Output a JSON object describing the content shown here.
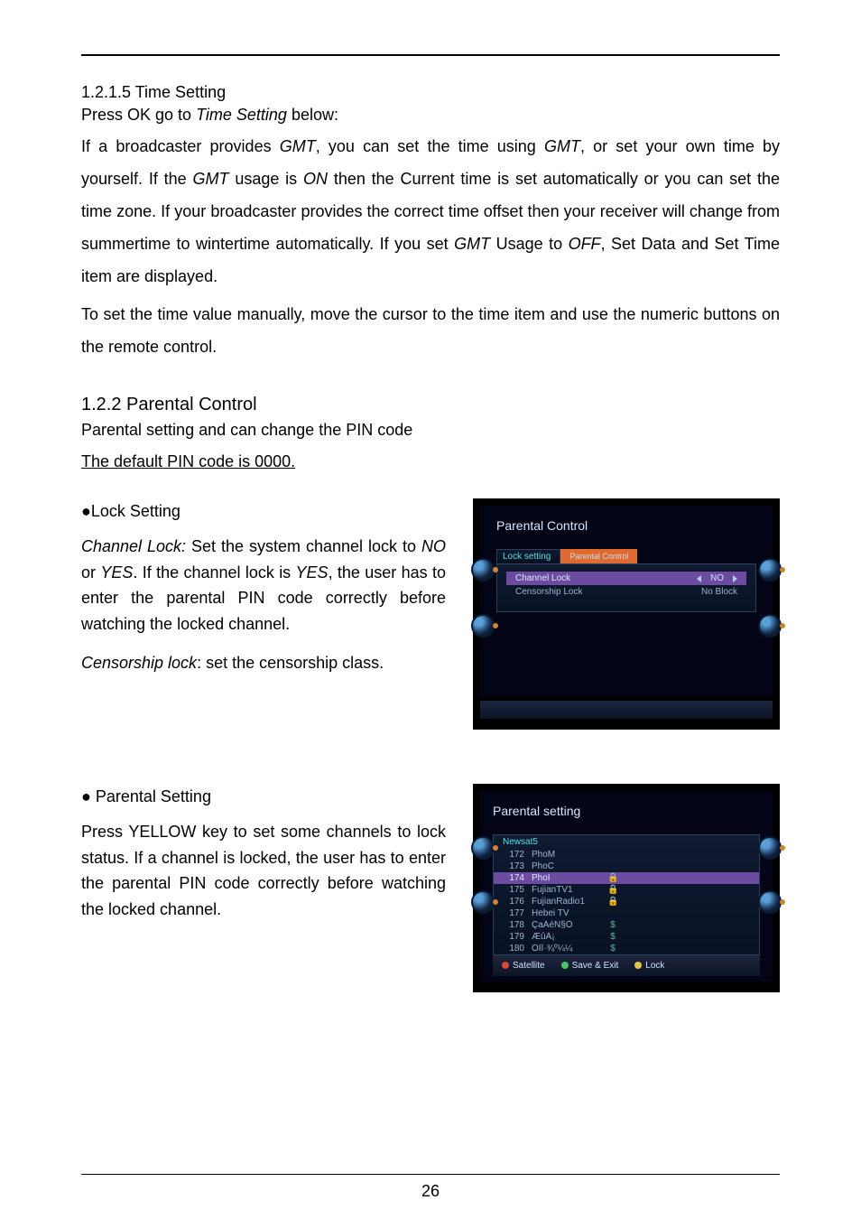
{
  "section1": {
    "heading": "1.2.1.5 Time Setting",
    "subline_pre": "Press OK go to ",
    "subline_em": "Time Setting",
    "subline_post": " below:",
    "para1_a": "If a broadcaster provides ",
    "para1_em1": "GMT",
    "para1_b": ", you can set the time using ",
    "para1_em2": "GMT",
    "para1_c": ", or set your own time by yourself. If the ",
    "para1_em3": "GMT",
    "para1_d": " usage is ",
    "para1_em4": "ON",
    "para1_e": " then the Current time is set automatically or you can set the time zone. If your broadcaster provides the correct time offset then your receiver will change from summertime to wintertime automatically. If you set ",
    "para1_em5": "GMT",
    "para1_f": " Usage to ",
    "para1_em6": "OFF",
    "para1_g": ", Set Data and Set Time item are displayed.",
    "para2": "To set the time value manually, move the cursor to the time item and use the numeric buttons on the remote control."
  },
  "section2": {
    "heading": "1.2.2 Parental Control",
    "sub1": "Parental setting and can change the PIN code",
    "default_pin": "The default PIN code is 0000.",
    "lock_heading": "●Lock Setting",
    "lock_em1": "Channel Lock:",
    "lock_a": " Set the system channel lock to ",
    "lock_em2": "NO",
    "lock_b": " or ",
    "lock_em3": "YES",
    "lock_c": ". If the channel lock is ",
    "lock_em4": "YES",
    "lock_d": ", the user has to enter the parental PIN code correctly before watching the locked channel.",
    "cens_em": "Censorship lock",
    "cens_txt": ": set the censorship class.",
    "parental_heading": "● Parental Setting",
    "parental_body": "Press YELLOW key to set some channels to lock status. If a channel is locked, the user has to enter the parental PIN code correctly before watching the locked channel."
  },
  "shot1": {
    "title": "Parental Control",
    "tab1": "Lock setting",
    "tab2": "Parental Control",
    "row1_label": "Channel Lock",
    "row1_value": "NO",
    "row2_label": "Censorship Lock",
    "row2_value": "No Block"
  },
  "shot2": {
    "title": "Parental setting",
    "sat": "Newsat5",
    "rows": [
      {
        "n": "172",
        "name": "PhoM",
        "icon": ""
      },
      {
        "n": "173",
        "name": "PhoC",
        "icon": ""
      },
      {
        "n": "174",
        "name": "PhoI",
        "icon": "lock",
        "sel": true
      },
      {
        "n": "175",
        "name": "FujianTV1",
        "icon": "lock"
      },
      {
        "n": "176",
        "name": "FujianRadio1",
        "icon": "lock"
      },
      {
        "n": "177",
        "name": "Hebei TV",
        "icon": ""
      },
      {
        "n": "178",
        "name": "ÇaÁéÑ§Ö",
        "icon": "$"
      },
      {
        "n": "179",
        "name": "ÆûÂ¡",
        "icon": "$"
      },
      {
        "n": "180",
        "name": "ÓÎÏ·¾º¼¼",
        "icon": "$"
      }
    ],
    "legend": {
      "a": "Satellite",
      "b": "Save & Exit",
      "c": "Lock"
    }
  },
  "page_number": "26"
}
